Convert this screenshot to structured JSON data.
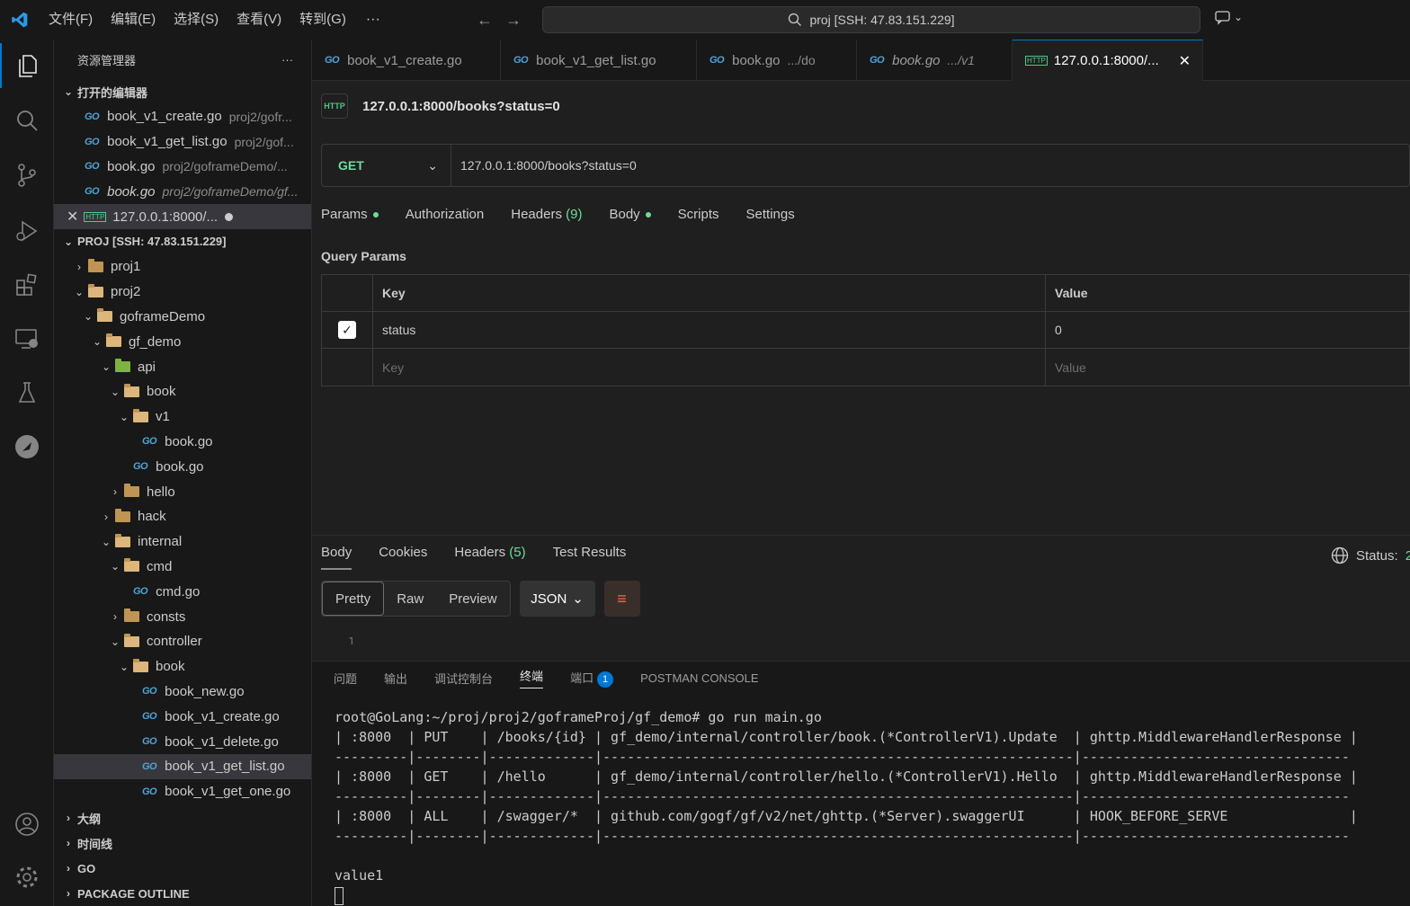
{
  "titlebar": {
    "menus": [
      "文件(F)",
      "编辑(E)",
      "选择(S)",
      "查看(V)",
      "转到(G)"
    ],
    "more": "···",
    "search": "proj [SSH: 47.83.151.229]"
  },
  "sidebar": {
    "title": "资源管理器",
    "more": "···",
    "open_editors_title": "打开的编辑器",
    "open_editors": [
      {
        "name": "book_v1_create.go",
        "path": "proj2/gofr..."
      },
      {
        "name": "book_v1_get_list.go",
        "path": "proj2/gof..."
      },
      {
        "name": "book.go",
        "path": "proj2/goframeDemo/..."
      },
      {
        "name": "book.go",
        "path": "proj2/goframeDemo/gf..."
      },
      {
        "name": "127.0.0.1:8000/...",
        "path": ""
      }
    ],
    "project_title": "PROJ [SSH: 47.83.151.229]",
    "tree": [
      {
        "label": "proj1",
        "type": "folder"
      },
      {
        "label": "proj2",
        "type": "folder-open"
      },
      {
        "label": "goframeDemo",
        "type": "folder-open"
      },
      {
        "label": "gf_demo",
        "type": "folder-open"
      },
      {
        "label": "api",
        "type": "folder-open-green"
      },
      {
        "label": "book",
        "type": "folder-open"
      },
      {
        "label": "v1",
        "type": "folder-open"
      },
      {
        "label": "book.go",
        "type": "go"
      },
      {
        "label": "book.go",
        "type": "go"
      },
      {
        "label": "hello",
        "type": "folder"
      },
      {
        "label": "hack",
        "type": "folder"
      },
      {
        "label": "internal",
        "type": "folder-open"
      },
      {
        "label": "cmd",
        "type": "folder-open"
      },
      {
        "label": "cmd.go",
        "type": "go"
      },
      {
        "label": "consts",
        "type": "folder"
      },
      {
        "label": "controller",
        "type": "folder-open"
      },
      {
        "label": "book",
        "type": "folder-open"
      },
      {
        "label": "book_new.go",
        "type": "go"
      },
      {
        "label": "book_v1_create.go",
        "type": "go"
      },
      {
        "label": "book_v1_delete.go",
        "type": "go"
      },
      {
        "label": "book_v1_get_list.go",
        "type": "go"
      },
      {
        "label": "book_v1_get_one.go",
        "type": "go"
      }
    ],
    "bottom_sections": [
      "大纲",
      "时间线",
      "GO",
      "PACKAGE OUTLINE"
    ]
  },
  "tabs": [
    {
      "name": "book_v1_create.go",
      "path": ""
    },
    {
      "name": "book_v1_get_list.go",
      "path": ""
    },
    {
      "name": "book.go",
      "path": ".../do"
    },
    {
      "name": "book.go",
      "path": ".../v1"
    },
    {
      "name": "127.0.0.1:8000/...",
      "path": ""
    }
  ],
  "request": {
    "title": "127.0.0.1:8000/books?status=0",
    "method": "GET",
    "url": "127.0.0.1:8000/books?status=0",
    "tabs": {
      "params": "Params",
      "authorization": "Authorization",
      "headers": "Headers",
      "headers_count": "(9)",
      "body": "Body",
      "scripts": "Scripts",
      "settings": "Settings"
    },
    "query_params_label": "Query Params",
    "table": {
      "key_header": "Key",
      "value_header": "Value",
      "row_key": "status",
      "row_value": "0",
      "key_placeholder": "Key",
      "value_placeholder": "Value"
    }
  },
  "response": {
    "tabs": {
      "body": "Body",
      "cookies": "Cookies",
      "headers": "Headers",
      "headers_count": "(5)",
      "test_results": "Test Results"
    },
    "status_label": "Status:",
    "status_value": "2",
    "views": [
      "Pretty",
      "Raw",
      "Preview"
    ],
    "format": "JSON",
    "line_number": "1"
  },
  "panel": {
    "tabs": [
      "问题",
      "输出",
      "调试控制台",
      "终端",
      "端口",
      "POSTMAN CONSOLE"
    ],
    "ports_badge": "1",
    "terminal_lines": [
      "root@GoLang:~/proj/proj2/goframeProj/gf_demo# go run main.go",
      "| :8000  | PUT    | /books/{id} | gf_demo/internal/controller/book.(*ControllerV1).Update  | ghttp.MiddlewareHandlerResponse |",
      "---------|--------|-------------|----------------------------------------------------------|---------------------------------",
      "| :8000  | GET    | /hello      | gf_demo/internal/controller/hello.(*ControllerV1).Hello  | ghttp.MiddlewareHandlerResponse |",
      "---------|--------|-------------|----------------------------------------------------------|---------------------------------",
      "| :8000  | ALL    | /swagger/*  | github.com/gogf/gf/v2/net/ghttp.(*Server).swaggerUI      | HOOK_BEFORE_SERVE               |",
      "---------|--------|-------------|----------------------------------------------------------|---------------------------------",
      "",
      "value1"
    ]
  }
}
